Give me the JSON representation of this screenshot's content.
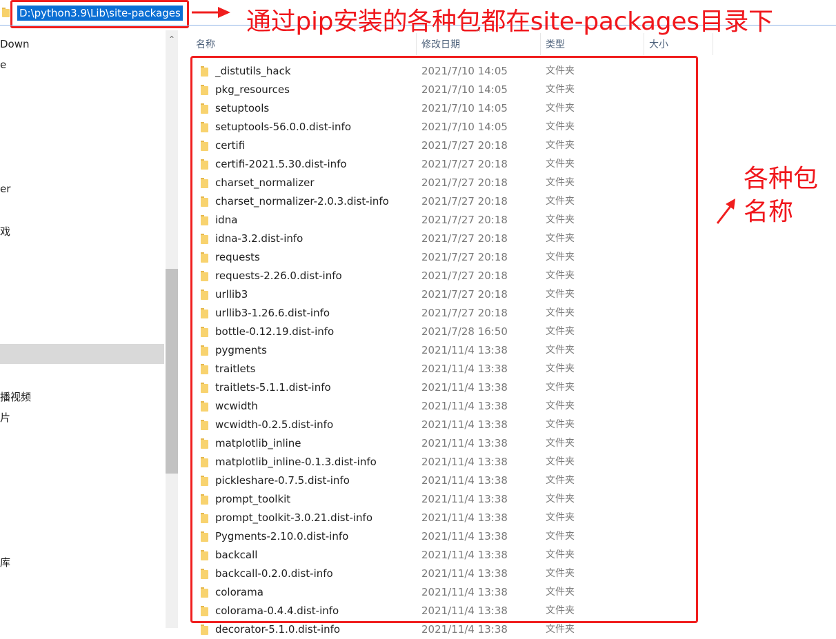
{
  "address_bar": {
    "path": "D:\\python3.9\\Lib\\site-packages",
    "icon": "folder-icon"
  },
  "annotations": {
    "top": "通过pip安装的各种包都在site-packages目录下",
    "right_line1": "各种包",
    "right_line2": "名称",
    "color": "#f01e1e"
  },
  "sidebar": {
    "items": [
      "Down",
      "e",
      "er",
      "戏",
      "播视频",
      "片",
      "库"
    ]
  },
  "columns": {
    "name": "名称",
    "date": "修改日期",
    "type": "类型",
    "size": "大小"
  },
  "files": [
    {
      "name": "_distutils_hack",
      "date": "2021/7/10 14:05",
      "type": "文件夹"
    },
    {
      "name": "pkg_resources",
      "date": "2021/7/10 14:05",
      "type": "文件夹"
    },
    {
      "name": "setuptools",
      "date": "2021/7/10 14:05",
      "type": "文件夹"
    },
    {
      "name": "setuptools-56.0.0.dist-info",
      "date": "2021/7/10 14:05",
      "type": "文件夹"
    },
    {
      "name": "certifi",
      "date": "2021/7/27 20:18",
      "type": "文件夹"
    },
    {
      "name": "certifi-2021.5.30.dist-info",
      "date": "2021/7/27 20:18",
      "type": "文件夹"
    },
    {
      "name": "charset_normalizer",
      "date": "2021/7/27 20:18",
      "type": "文件夹"
    },
    {
      "name": "charset_normalizer-2.0.3.dist-info",
      "date": "2021/7/27 20:18",
      "type": "文件夹"
    },
    {
      "name": "idna",
      "date": "2021/7/27 20:18",
      "type": "文件夹"
    },
    {
      "name": "idna-3.2.dist-info",
      "date": "2021/7/27 20:18",
      "type": "文件夹"
    },
    {
      "name": "requests",
      "date": "2021/7/27 20:18",
      "type": "文件夹"
    },
    {
      "name": "requests-2.26.0.dist-info",
      "date": "2021/7/27 20:18",
      "type": "文件夹"
    },
    {
      "name": "urllib3",
      "date": "2021/7/27 20:18",
      "type": "文件夹"
    },
    {
      "name": "urllib3-1.26.6.dist-info",
      "date": "2021/7/27 20:18",
      "type": "文件夹"
    },
    {
      "name": "bottle-0.12.19.dist-info",
      "date": "2021/7/28 16:50",
      "type": "文件夹"
    },
    {
      "name": "pygments",
      "date": "2021/11/4 13:38",
      "type": "文件夹"
    },
    {
      "name": "traitlets",
      "date": "2021/11/4 13:38",
      "type": "文件夹"
    },
    {
      "name": "traitlets-5.1.1.dist-info",
      "date": "2021/11/4 13:38",
      "type": "文件夹"
    },
    {
      "name": "wcwidth",
      "date": "2021/11/4 13:38",
      "type": "文件夹"
    },
    {
      "name": "wcwidth-0.2.5.dist-info",
      "date": "2021/11/4 13:38",
      "type": "文件夹"
    },
    {
      "name": "matplotlib_inline",
      "date": "2021/11/4 13:38",
      "type": "文件夹"
    },
    {
      "name": "matplotlib_inline-0.1.3.dist-info",
      "date": "2021/11/4 13:38",
      "type": "文件夹"
    },
    {
      "name": "pickleshare-0.7.5.dist-info",
      "date": "2021/11/4 13:38",
      "type": "文件夹"
    },
    {
      "name": "prompt_toolkit",
      "date": "2021/11/4 13:38",
      "type": "文件夹"
    },
    {
      "name": "prompt_toolkit-3.0.21.dist-info",
      "date": "2021/11/4 13:38",
      "type": "文件夹"
    },
    {
      "name": "Pygments-2.10.0.dist-info",
      "date": "2021/11/4 13:38",
      "type": "文件夹"
    },
    {
      "name": "backcall",
      "date": "2021/11/4 13:38",
      "type": "文件夹"
    },
    {
      "name": "backcall-0.2.0.dist-info",
      "date": "2021/11/4 13:38",
      "type": "文件夹"
    },
    {
      "name": "colorama",
      "date": "2021/11/4 13:38",
      "type": "文件夹"
    },
    {
      "name": "colorama-0.4.4.dist-info",
      "date": "2021/11/4 13:38",
      "type": "文件夹"
    },
    {
      "name": "decorator-5.1.0.dist-info",
      "date": "2021/11/4 13:38",
      "type": "文件夹"
    }
  ]
}
